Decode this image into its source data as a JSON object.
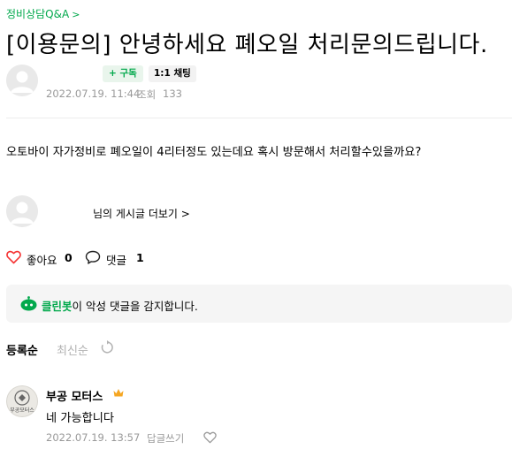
{
  "post": {
    "board_link": "정비상담Q&A",
    "title": "[이용문의] 안녕하세요 폐오일 처리문의드립니다.",
    "subscribe_label": "+ 구독",
    "chat_label": "1:1 채팅",
    "date": "2022.07.19. 11:44",
    "views_label": "조회",
    "views": "133",
    "body": "오토바이 자가정비로 폐오일이 4리터정도 있는데요 혹시 방문해서 처리할수있을까요?",
    "author_posts_link": "님의 게시글 더보기"
  },
  "reactions": {
    "like_label": "좋아요",
    "like_count": "0",
    "comment_label": "댓글",
    "comment_count": "1"
  },
  "cleanbot": {
    "name": "클린봇",
    "message": "이 악성 댓글을 감지합니다."
  },
  "comment_sort": {
    "registered": "등록순",
    "latest": "최신순"
  },
  "comments": [
    {
      "author": "부공 모터스",
      "avatar_text": "부공모터스",
      "text": "네 가능합니다",
      "date": "2022.07.19. 13:57",
      "reply_label": "답글쓰기"
    }
  ],
  "colors": {
    "accent": "#03a94d",
    "like_icon": "#f53535",
    "crown": "#f5a623",
    "meta_text": "#999999"
  }
}
